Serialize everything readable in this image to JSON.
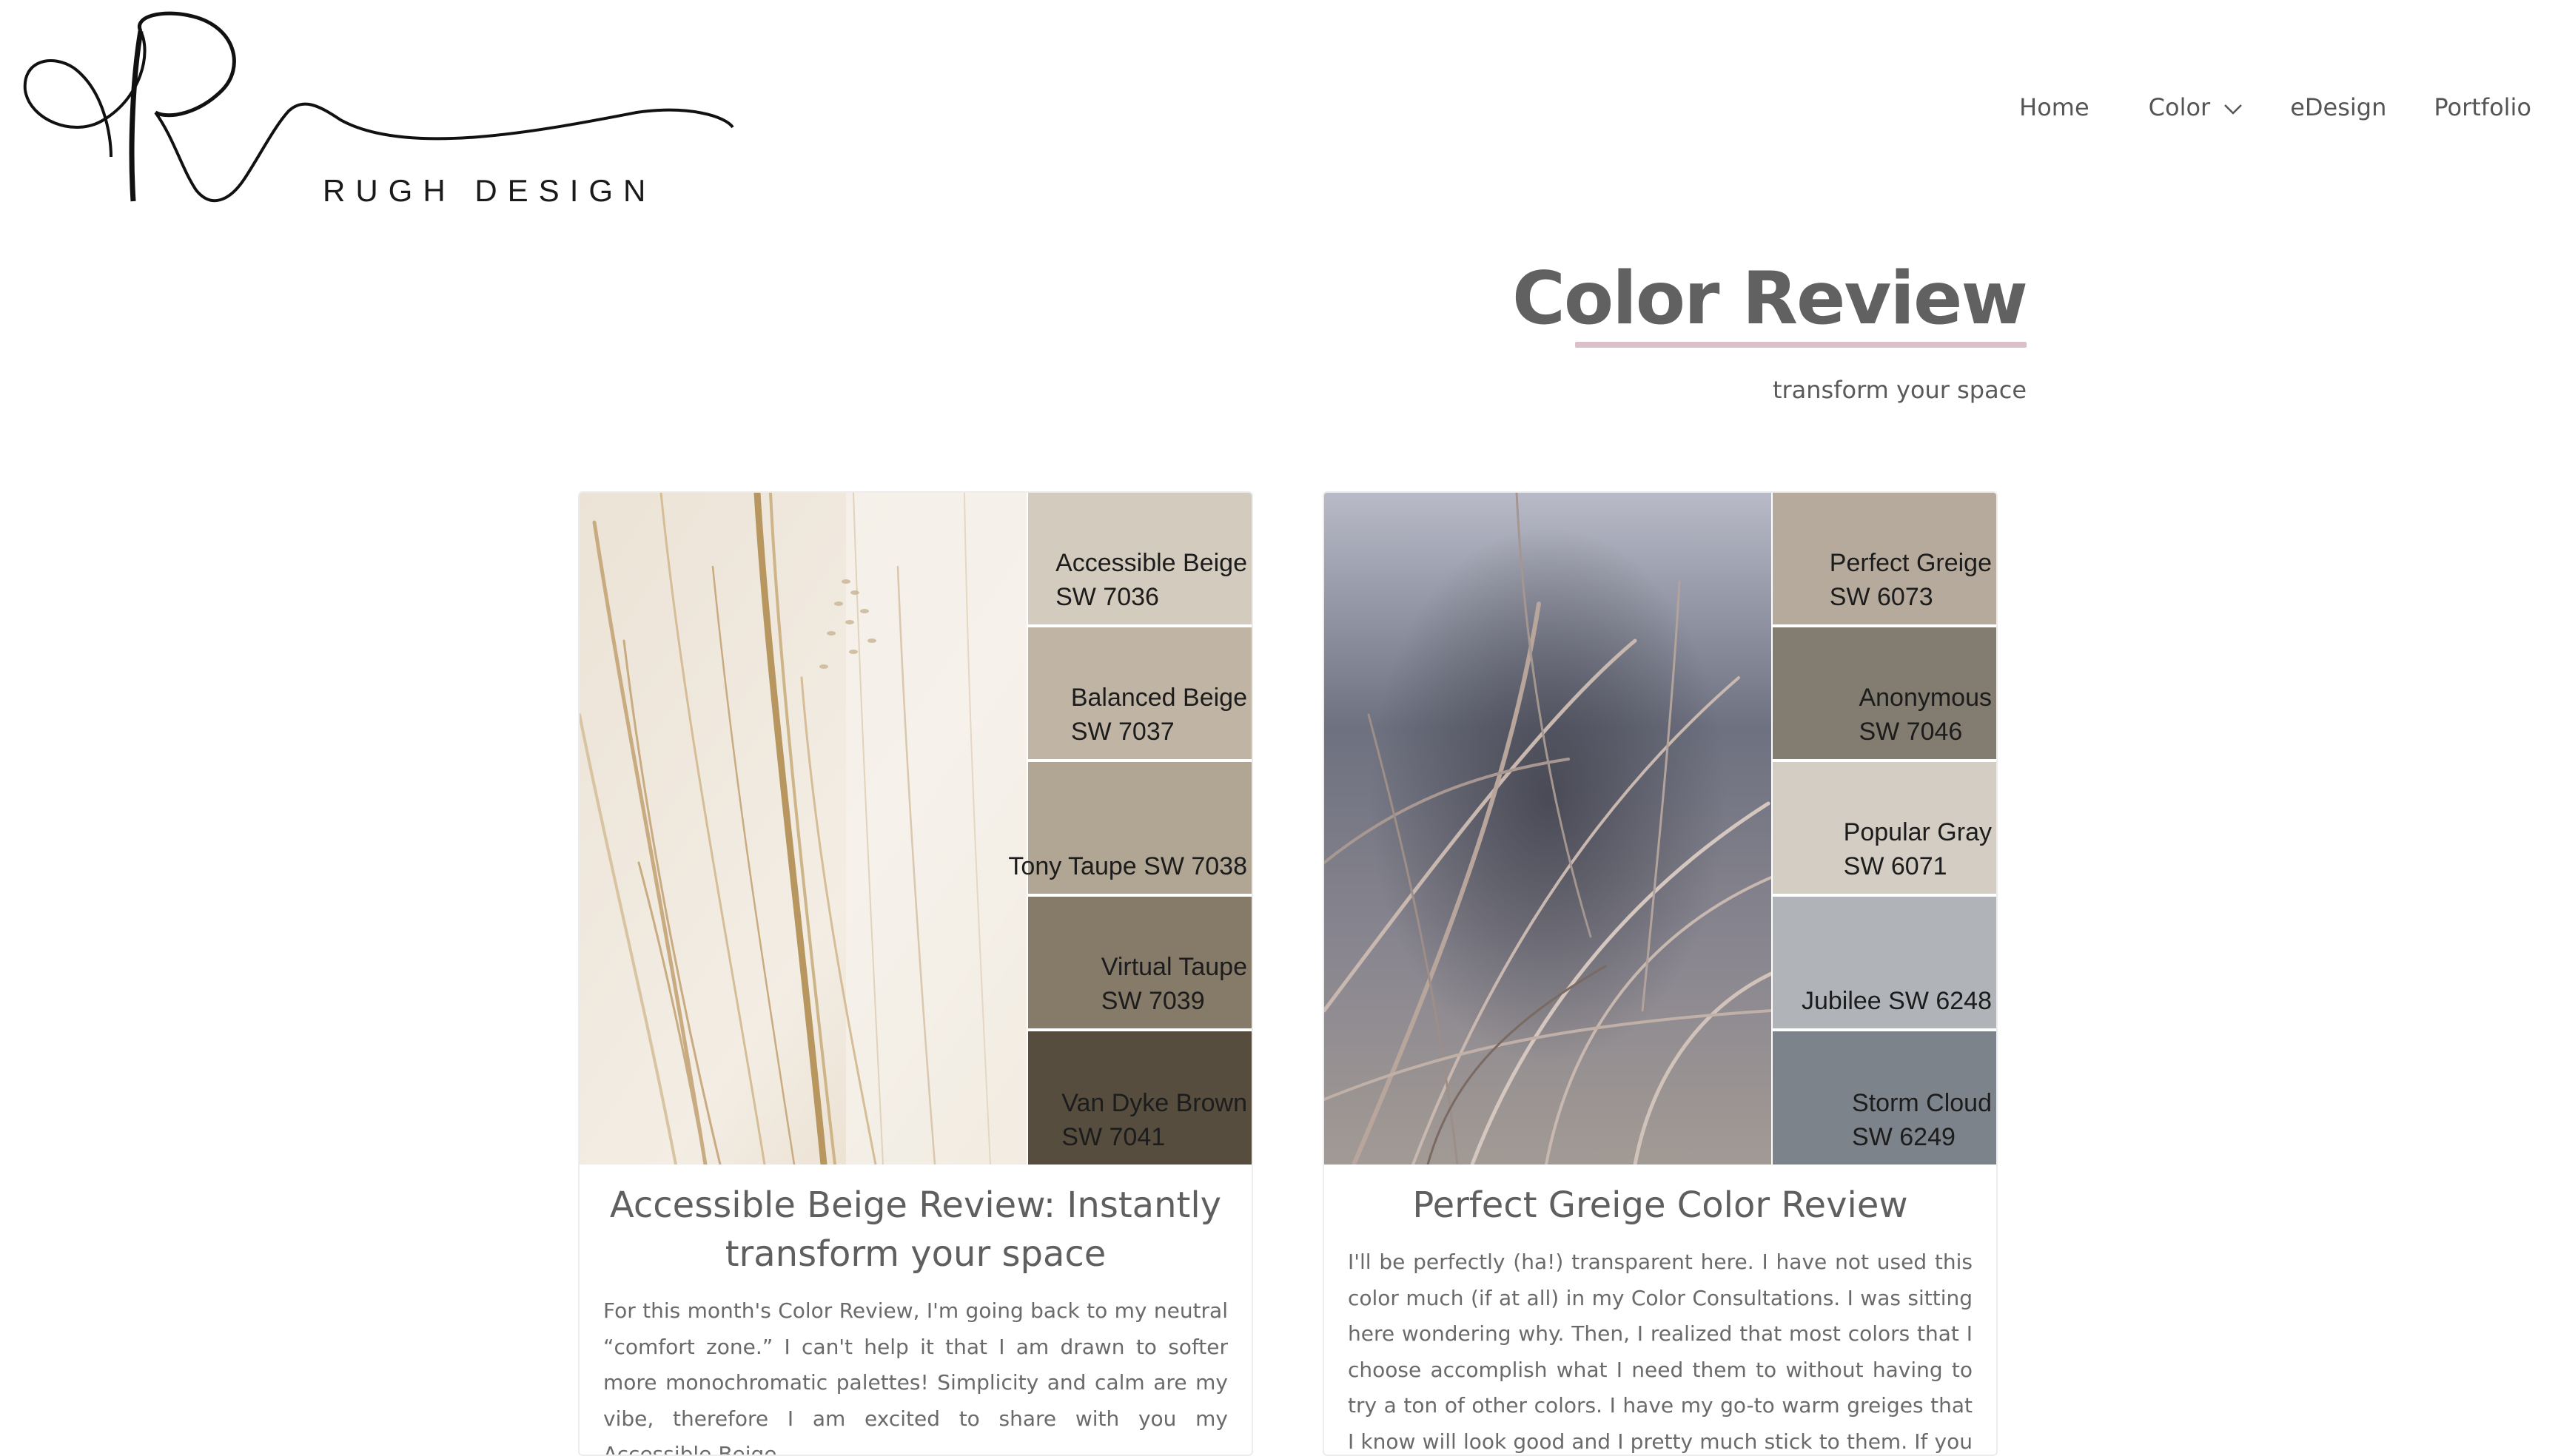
{
  "brand": {
    "name": "RUGH DESIGN"
  },
  "nav": {
    "items": [
      {
        "label": "Home"
      },
      {
        "label": "Color"
      },
      {
        "label": "eDesign"
      },
      {
        "label": "Portfolio"
      }
    ]
  },
  "page": {
    "title": "Color Review",
    "subtitle": "transform your space"
  },
  "cards": [
    {
      "title": "Accessible Beige Review: Instantly transform your space",
      "excerpt": "For this month's Color Review, I'm going back to my neutral “comfort zone.” I can't help it that I am drawn to softer more monochromatic palettes! Simplicity and calm are my vibe, therefore I am excited to share with you my Accessible Beige",
      "swatches": [
        {
          "line1": "Accessible Beige",
          "line2": "SW 7036",
          "color": "#d3cbbd"
        },
        {
          "line1": "Balanced Beige",
          "line2": "SW 7037",
          "color": "#c0b5a5"
        },
        {
          "line1": "",
          "line2": "Tony Taupe SW 7038",
          "color": "#b1a693"
        },
        {
          "line1": "Virtual Taupe",
          "line2": "SW 7039",
          "color": "#867b69"
        },
        {
          "line1": "Van Dyke Brown",
          "line2": "SW 7041",
          "color": "#564d3f"
        }
      ]
    },
    {
      "title": "Perfect Greige Color Review",
      "excerpt": "I'll be perfectly (ha!) transparent here. I have not used this color much (if at all) in my Color Consultations. I was sitting here wondering why. Then, I realized that most colors that I choose accomplish what I need them to without having to try a ton of other colors. I have my go-to warm greiges that I know will look good and I pretty much stick to them. If you are wondering what",
      "swatches": [
        {
          "line1": "Perfect Greige",
          "line2": "SW 6073",
          "color": "#b6aa9d"
        },
        {
          "line1": "Anonymous",
          "line2": "SW 7046",
          "color": "#837c70"
        },
        {
          "line1": "Popular Gray",
          "line2": "SW 6071",
          "color": "#d3cdc4"
        },
        {
          "line1": "",
          "line2": "Jubilee SW 6248",
          "color": "#b0b4b8"
        },
        {
          "line1": "Storm Cloud",
          "line2": "SW 6249",
          "color": "#7c838b"
        }
      ]
    }
  ]
}
